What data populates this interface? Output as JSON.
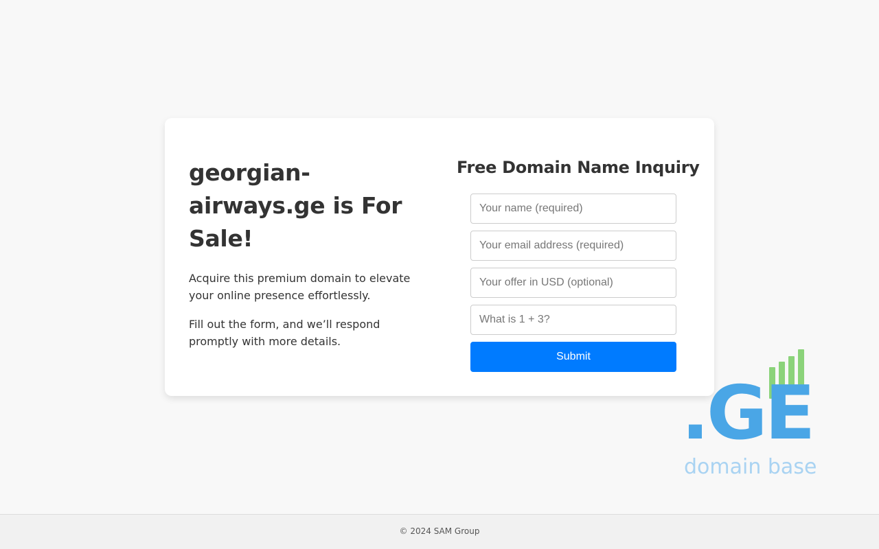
{
  "sale": {
    "heading": "georgian-airways.ge is For Sale!",
    "paragraph1": "Acquire this premium domain to elevate your online presence effortlessly.",
    "paragraph2": "Fill out the form, and we’ll respond promptly with more details."
  },
  "form": {
    "title": "Free Domain Name Inquiry",
    "name_placeholder": "Your name (required)",
    "email_placeholder": "Your email address (required)",
    "offer_placeholder": "Your offer in USD (optional)",
    "captcha_placeholder": "What is 1 + 3?",
    "submit_label": "Submit"
  },
  "logo": {
    "mark": ".GE",
    "tagline": "domain base"
  },
  "footer": {
    "copyright": "© 2024 SAM Group"
  },
  "colors": {
    "accent_button": "#007bff",
    "logo_blue": "#4aa6e6",
    "logo_green": "#8bd37a",
    "logo_tagline": "#a9d3f2"
  }
}
